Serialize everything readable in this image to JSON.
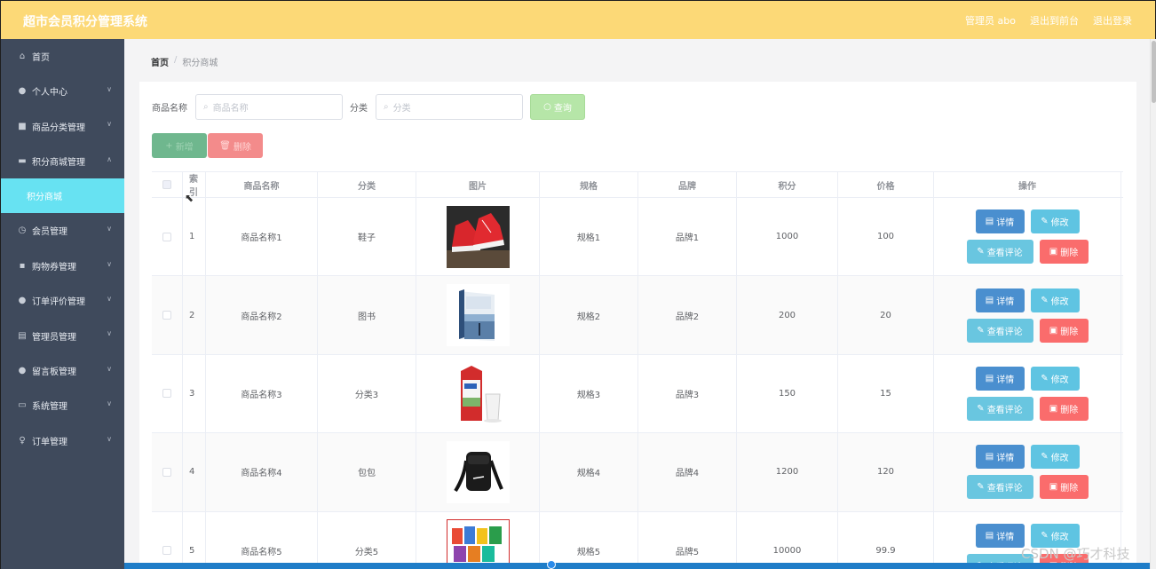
{
  "app": {
    "title": "超市会员积分管理系统",
    "header_links": [
      "管理员 abo",
      "退出到前台",
      "退出登录"
    ]
  },
  "sidebar": {
    "items": [
      {
        "label": "首页",
        "icon": "home-icon",
        "expandable": false
      },
      {
        "label": "个人中心",
        "icon": "user-icon",
        "expandable": true
      },
      {
        "label": "商品分类管理",
        "icon": "folder-icon",
        "expandable": true
      },
      {
        "label": "积分商城管理",
        "icon": "shop-icon",
        "expandable": true,
        "expanded": true
      },
      {
        "label": "会员管理",
        "icon": "clock-icon",
        "expandable": true
      },
      {
        "label": "购物券管理",
        "icon": "chat-icon",
        "expandable": true
      },
      {
        "label": "订单评价管理",
        "icon": "user-icon",
        "expandable": true
      },
      {
        "label": "管理员管理",
        "icon": "clipboard-icon",
        "expandable": true
      },
      {
        "label": "留言板管理",
        "icon": "user-icon",
        "expandable": true
      },
      {
        "label": "系统管理",
        "icon": "monitor-icon",
        "expandable": true
      },
      {
        "label": "订单管理",
        "icon": "bulb-icon",
        "expandable": true
      }
    ],
    "active_sub": "积分商城"
  },
  "breadcrumb": {
    "home": "首页",
    "sep": "/",
    "current": "积分商城"
  },
  "search": {
    "name_label": "商品名称",
    "name_placeholder": "商品名称",
    "category_label": "分类",
    "category_placeholder": "分类",
    "query_button": "查询"
  },
  "actions": {
    "add": "新增",
    "delete": "删除"
  },
  "table": {
    "headers": [
      "索引",
      "商品名称",
      "分类",
      "图片",
      "规格",
      "品牌",
      "积分",
      "价格",
      "操作"
    ],
    "rows": [
      {
        "index": "1",
        "name": "商品名称1",
        "category": "鞋子",
        "spec": "规格1",
        "brand": "品牌1",
        "points": "1000",
        "price": "100",
        "image": "red-sneakers"
      },
      {
        "index": "2",
        "name": "商品名称2",
        "category": "图书",
        "spec": "规格2",
        "brand": "品牌2",
        "points": "200",
        "price": "20",
        "image": "book"
      },
      {
        "index": "3",
        "name": "商品名称3",
        "category": "分类3",
        "spec": "规格3",
        "brand": "品牌3",
        "points": "150",
        "price": "15",
        "image": "milk-carton"
      },
      {
        "index": "4",
        "name": "商品名称4",
        "category": "包包",
        "spec": "规格4",
        "brand": "品牌4",
        "points": "1200",
        "price": "120",
        "image": "black-bag"
      },
      {
        "index": "5",
        "name": "商品名称5",
        "category": "分类5",
        "spec": "规格5",
        "brand": "品牌5",
        "points": "10000",
        "price": "99.9",
        "image": "snack-box"
      }
    ],
    "row_actions": {
      "detail": "详情",
      "edit": "修改",
      "review": "查看评论",
      "delete": "删除"
    }
  },
  "watermark": "CSDN @巧才科技",
  "colors": {
    "header": "#fcd977",
    "sidebar": "#3f4a5c",
    "active_sub": "#67e2f2",
    "detail": "#4a8fcf",
    "edit": "#5fc4e2",
    "delete": "#fa6c6c"
  }
}
